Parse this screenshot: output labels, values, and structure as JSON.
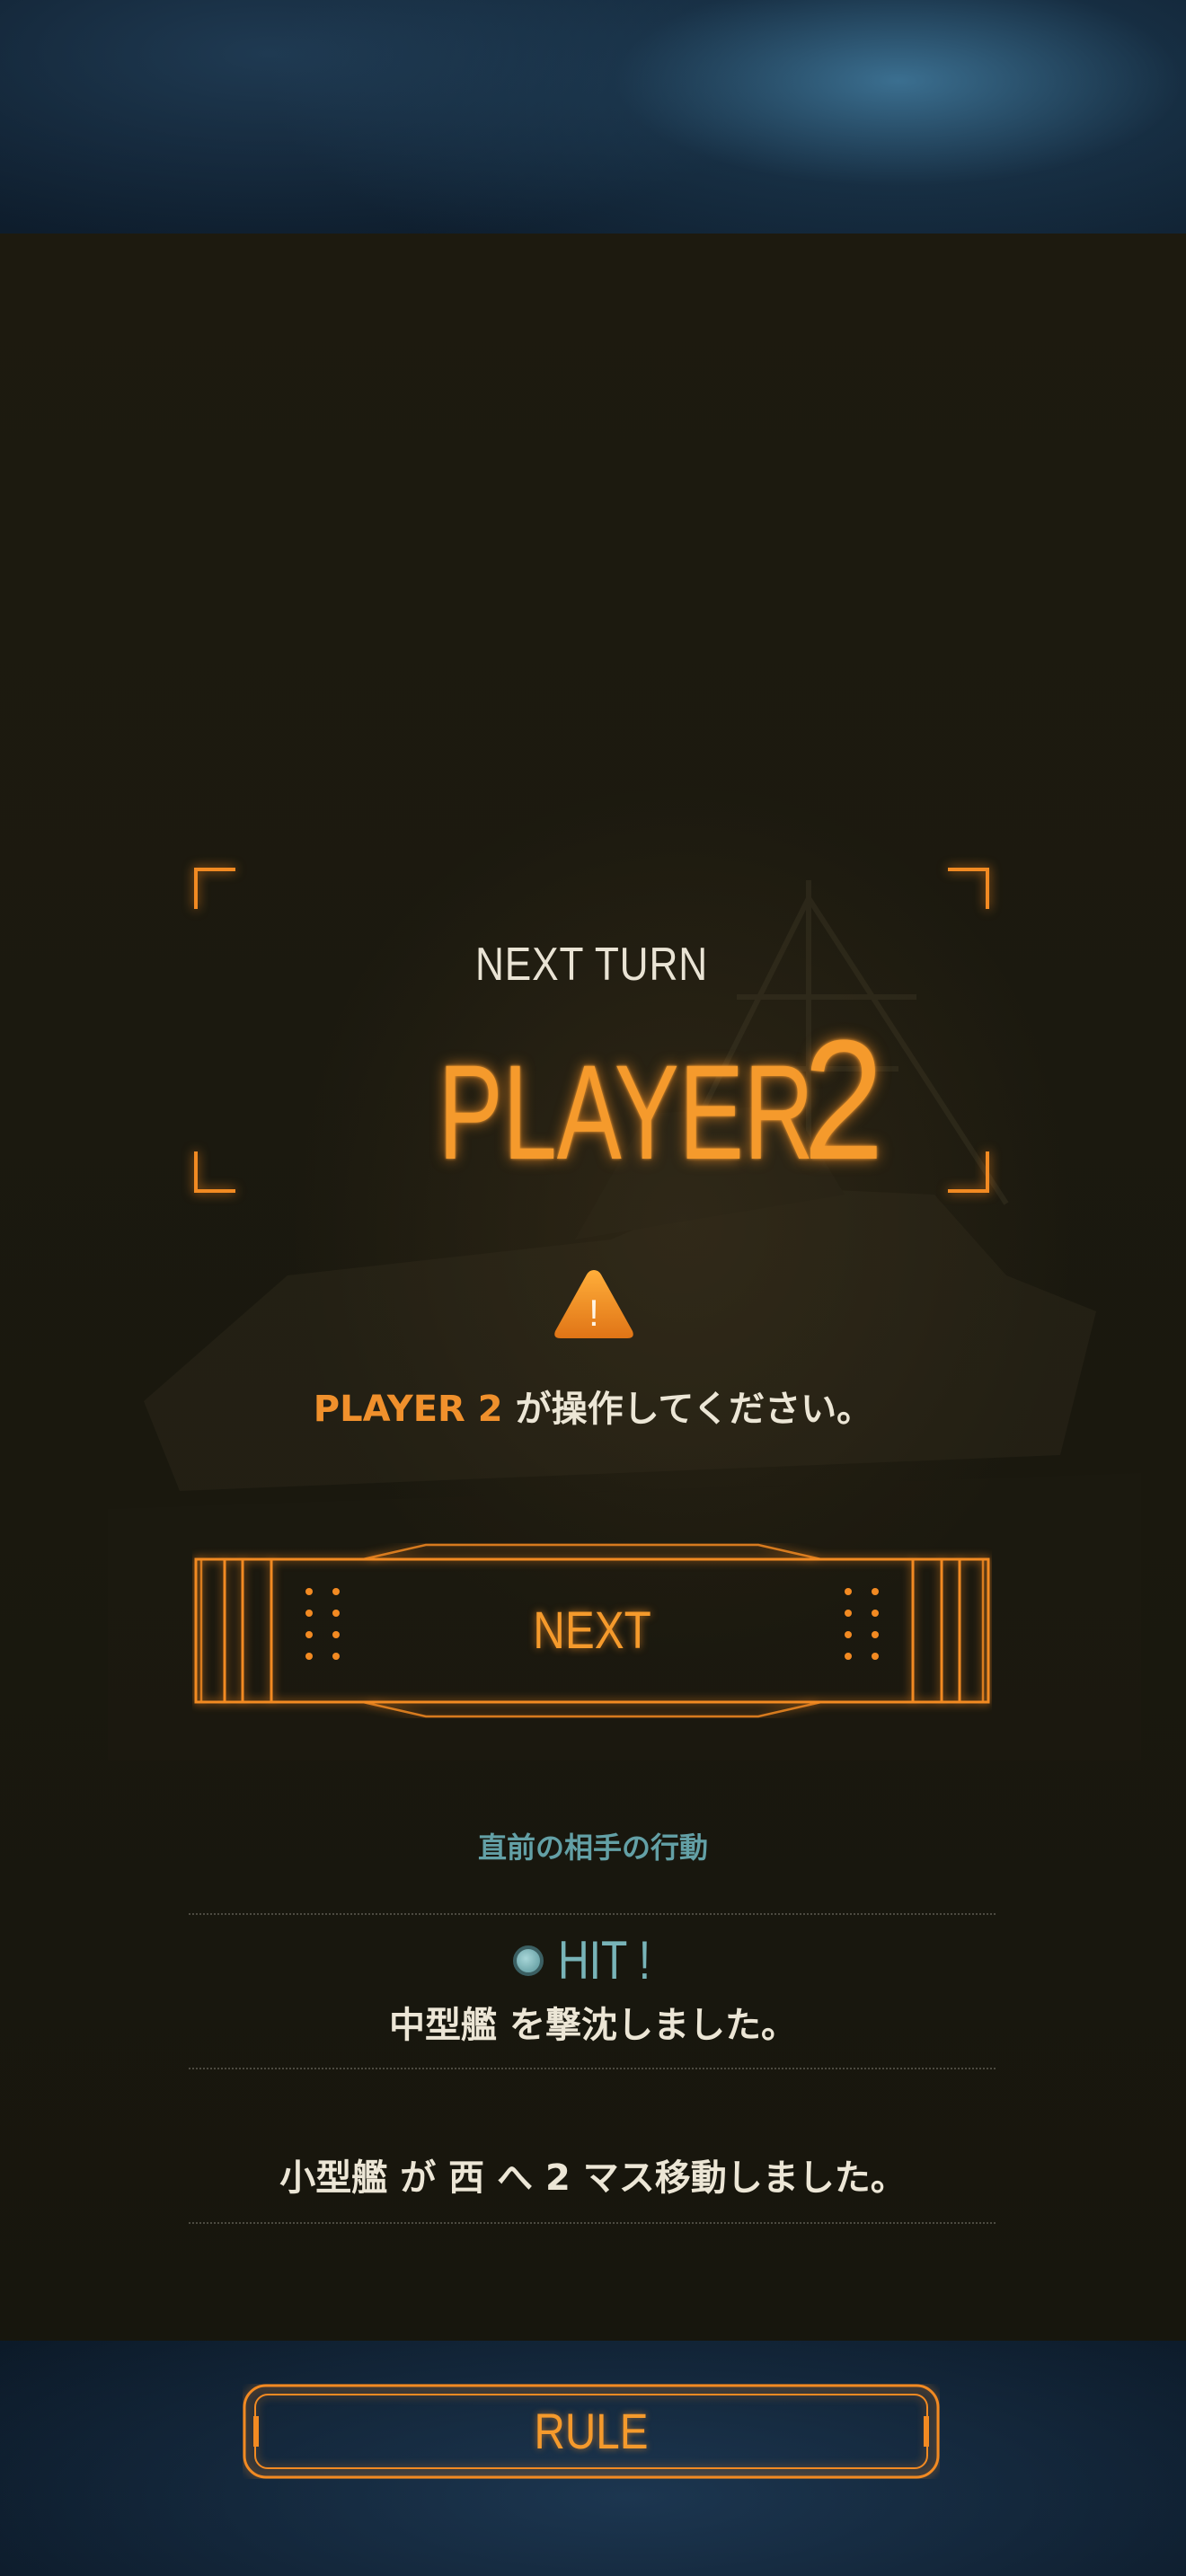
{
  "turn": {
    "label": "NEXT TURN",
    "player_word": "PLAYER",
    "player_number": "2"
  },
  "warning": {
    "icon": "warning-triangle-icon",
    "glyph": "!",
    "player": "PLAYER 2",
    "message": "が操作してください。"
  },
  "next_button": {
    "label": "NEXT"
  },
  "previous_action": {
    "heading": "直前の相手の行動",
    "hit": {
      "icon": "hit-marker-icon",
      "label": "HIT !",
      "message": "中型艦 を撃沈しました。"
    },
    "move": {
      "message": "小型艦 が 西 へ 2 マス移動しました。"
    }
  },
  "rule_button": {
    "label": "RULE"
  },
  "colors": {
    "accent": "#f59a2c",
    "hit": "#78b4b8",
    "heading": "#63a0a6",
    "panel": "#1d1a0f",
    "text": "#ece6d6"
  }
}
